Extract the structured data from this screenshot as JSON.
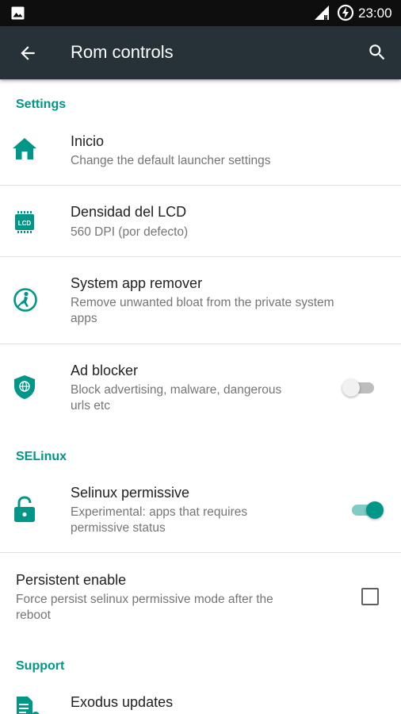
{
  "status_bar": {
    "time": "23:00",
    "icons": [
      "image-notification-icon",
      "signal-icon",
      "battery-charging-icon"
    ]
  },
  "toolbar": {
    "title": "Rom controls",
    "back_icon": "back-arrow-icon",
    "search_icon": "search-icon"
  },
  "sections": {
    "settings": "Settings",
    "selinux": "SELinux",
    "support": "Support"
  },
  "items": {
    "inicio": {
      "title": "Inicio",
      "summary": "Change the default launcher settings",
      "icon": "home-icon"
    },
    "lcd": {
      "title": "Densidad del LCD",
      "summary": "560 DPI (por defecto)",
      "icon": "lcd-chip-icon"
    },
    "app_remover": {
      "title": "System app remover",
      "summary_line1": "Remove unwanted bloat from the private system",
      "summary_line2": "apps",
      "icon": "sweeper-icon"
    },
    "ad_blocker": {
      "title": "Ad blocker",
      "summary_line1": "Block advertising, malware, dangerous",
      "summary_line2": "urls etc",
      "icon": "shield-globe-icon",
      "enabled": false
    },
    "selinux_permissive": {
      "title": "Selinux permissive",
      "summary_line1": "Experimental: apps that requires",
      "summary_line2": "permissive status",
      "icon": "unlock-icon",
      "enabled": true
    },
    "persistent": {
      "title": "Persistent enable",
      "summary_line1": "Force persist selinux permissive mode after the",
      "summary_line2": "reboot",
      "checked": false
    },
    "exodus_updates": {
      "title": "Exodus updates",
      "icon": "document-update-icon"
    }
  },
  "colors": {
    "accent": "#009688",
    "toolbar": "#263238",
    "statusbar": "#0e0e0e",
    "switch_off_track": "#bdbdbd",
    "switch_off_thumb": "#f1f1f1",
    "switch_on_track": "#80cbc4"
  }
}
